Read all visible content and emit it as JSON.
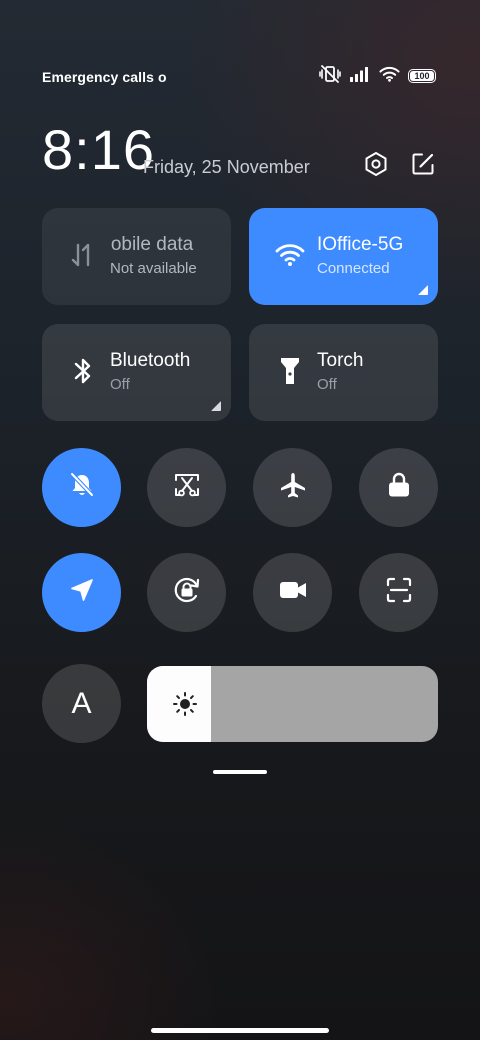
{
  "status_bar": {
    "carrier_text": "Emergency calls only",
    "battery_level": 100,
    "battery_text": "100",
    "icons": [
      "vibrate-off-icon",
      "signal-icon",
      "wifi-icon",
      "battery-icon"
    ]
  },
  "header": {
    "time": "8:16",
    "date": "Friday, 25 November",
    "icons": [
      "settings-hex-icon",
      "edit-icon"
    ]
  },
  "tiles": [
    {
      "title": "Mobile data",
      "subtitle": "Not available",
      "icon": "mobile-data-arrows-icon",
      "state": "unavailable"
    },
    {
      "title": "IOffice-5G",
      "subtitle": "Connected",
      "icon": "wifi-icon",
      "state": "on"
    },
    {
      "title": "Bluetooth",
      "subtitle": "Off",
      "icon": "bluetooth-icon",
      "state": "off"
    },
    {
      "title": "Torch",
      "subtitle": "Off",
      "icon": "torch-icon",
      "state": "off"
    }
  ],
  "toggles": [
    {
      "icon": "silent-bell-icon",
      "state": "on"
    },
    {
      "icon": "screenshot-scissors-icon",
      "state": "off"
    },
    {
      "icon": "airplane-icon",
      "state": "off"
    },
    {
      "icon": "lock-icon",
      "state": "off"
    },
    {
      "icon": "location-arrow-icon",
      "state": "on"
    },
    {
      "icon": "rotation-lock-icon",
      "state": "off"
    },
    {
      "icon": "video-camera-icon",
      "state": "off"
    },
    {
      "icon": "scan-icon",
      "state": "off"
    }
  ],
  "auto_brightness": {
    "label": "A"
  },
  "brightness": {
    "level_fraction": 0.22,
    "icon": "sun-icon"
  },
  "colors": {
    "accent": "#3e8bff",
    "tile_off": "#343a42",
    "slider_track": "#a5a5a5",
    "slider_fill": "#fdfdfd"
  }
}
